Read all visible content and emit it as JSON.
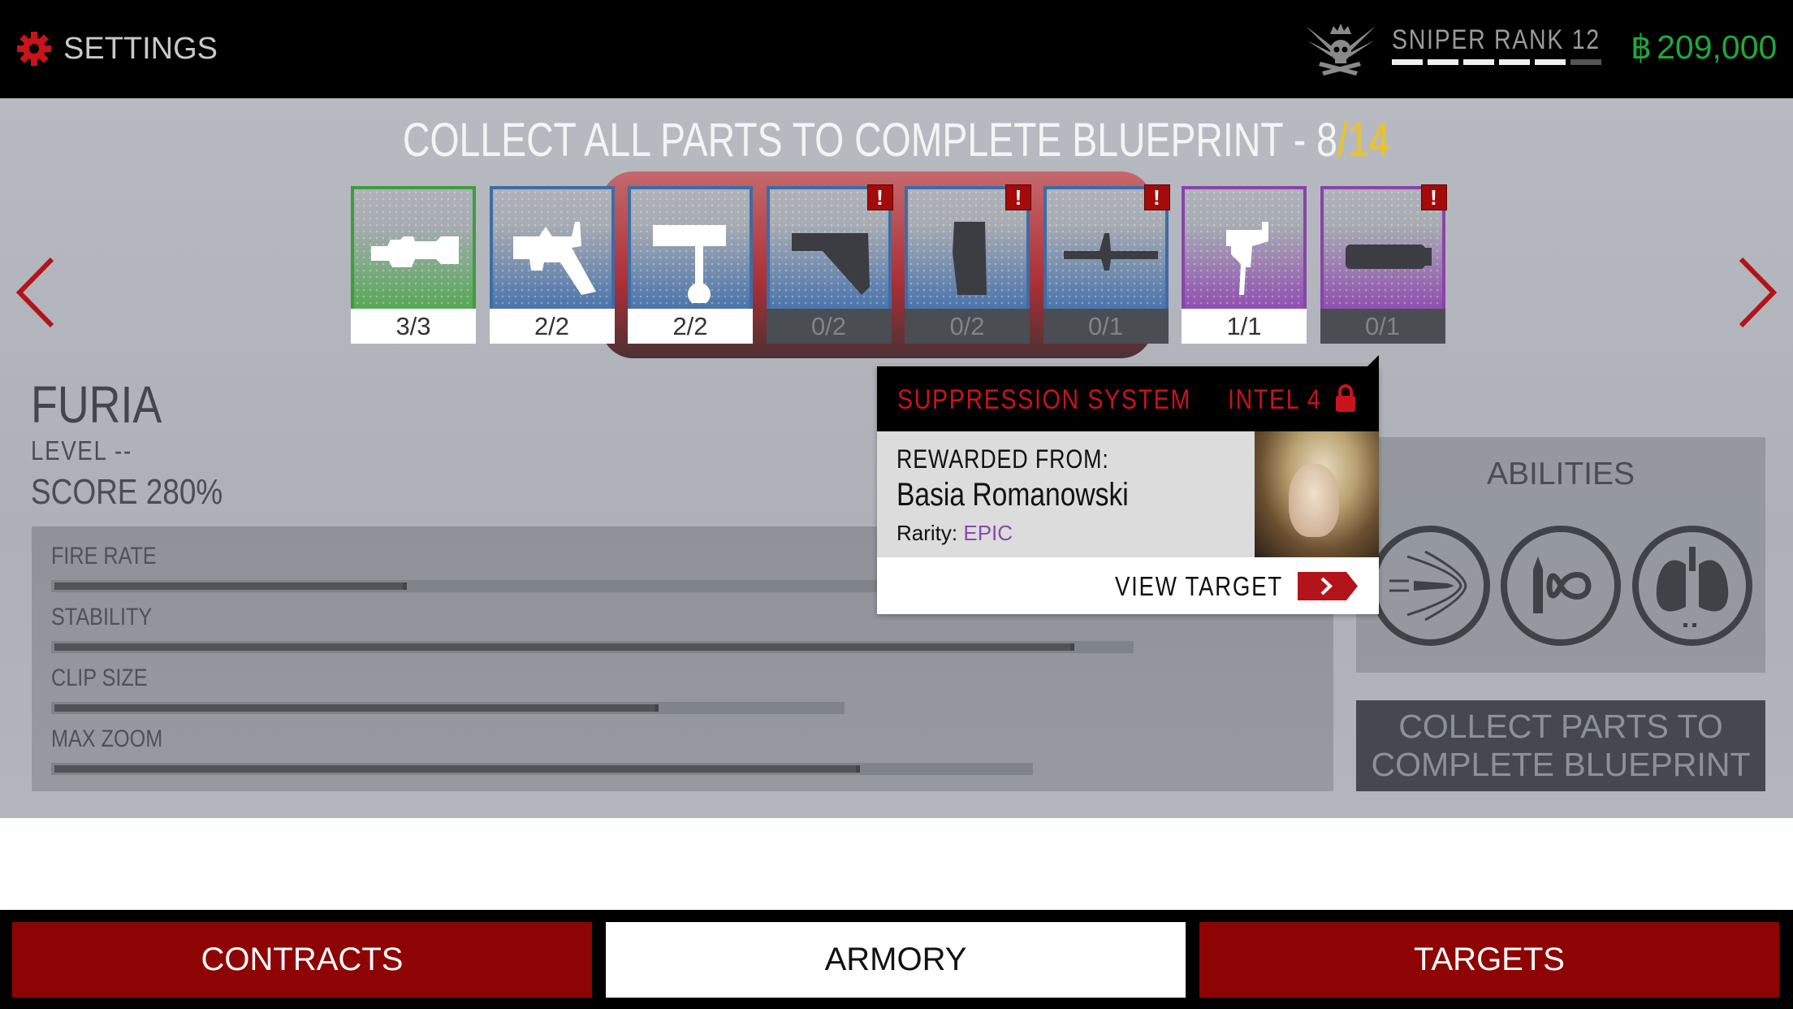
{
  "header": {
    "settings_label": "SETTINGS",
    "settings_icon": "gear-icon",
    "rank_label": "SNIPER RANK 12",
    "rank_progress": {
      "filled_segments": 5,
      "total_segments": 6
    },
    "currency_symbol": "฿",
    "money": "209,000",
    "colors": {
      "accent": "#c8141a",
      "money": "#1fa83a"
    }
  },
  "blueprint": {
    "title_prefix": "COLLECT ALL PARTS TO COMPLETE BLUEPRINT - ",
    "collected": "8",
    "total": "/14",
    "parts": [
      {
        "icon": "scope-icon",
        "count": "3/3",
        "rarity": "green",
        "complete": true,
        "alert": false
      },
      {
        "icon": "receiver-icon",
        "count": "2/2",
        "rarity": "blue",
        "complete": true,
        "alert": false
      },
      {
        "icon": "bolt-icon",
        "count": "2/2",
        "rarity": "blue",
        "complete": true,
        "alert": false
      },
      {
        "icon": "stock-icon",
        "count": "0/2",
        "rarity": "blue",
        "complete": false,
        "alert": true
      },
      {
        "icon": "magazine-icon",
        "count": "0/2",
        "rarity": "blue",
        "complete": false,
        "alert": true
      },
      {
        "icon": "barrel-icon",
        "count": "0/1",
        "rarity": "blue",
        "complete": false,
        "alert": true
      },
      {
        "icon": "trigger-icon",
        "count": "1/1",
        "rarity": "purple",
        "complete": true,
        "alert": false
      },
      {
        "icon": "suppressor-icon",
        "count": "0/1",
        "rarity": "purple",
        "complete": false,
        "alert": true
      }
    ],
    "alert_glyph": "!"
  },
  "weapon": {
    "name": "FURIA",
    "level": "LEVEL --",
    "score": "SCORE 280%",
    "stats": [
      {
        "label": "FIRE RATE",
        "value_pct": 28,
        "max_pct": 86
      },
      {
        "label": "STABILITY",
        "value_pct": 81,
        "max_pct": 86
      },
      {
        "label": "CLIP SIZE",
        "value_pct": 48,
        "max_pct": 63
      },
      {
        "label": "MAX ZOOM",
        "value_pct": 64,
        "max_pct": 78
      }
    ]
  },
  "popup": {
    "part_name": "SUPPRESSION SYSTEM",
    "intel": "INTEL 4",
    "rewarded_from_label": "REWARDED FROM:",
    "target_name": "Basia Romanowski",
    "rarity_label": "Rarity:",
    "rarity_value": "EPIC",
    "view_target_label": "VIEW TARGET",
    "colors": {
      "title": "#c8141a",
      "epic": "#8a4aa8"
    }
  },
  "abilities": {
    "title": "ABILITIES",
    "items": [
      {
        "icon": "piercing-bullet-icon"
      },
      {
        "icon": "infinite-ammo-icon"
      },
      {
        "icon": "lungs-icon"
      }
    ],
    "collect_line1": "COLLECT PARTS TO",
    "collect_line2": "COMPLETE BLUEPRINT"
  },
  "nav": {
    "tabs": [
      {
        "label": "CONTRACTS",
        "active": false
      },
      {
        "label": "ARMORY",
        "active": true
      },
      {
        "label": "TARGETS",
        "active": false
      }
    ]
  }
}
